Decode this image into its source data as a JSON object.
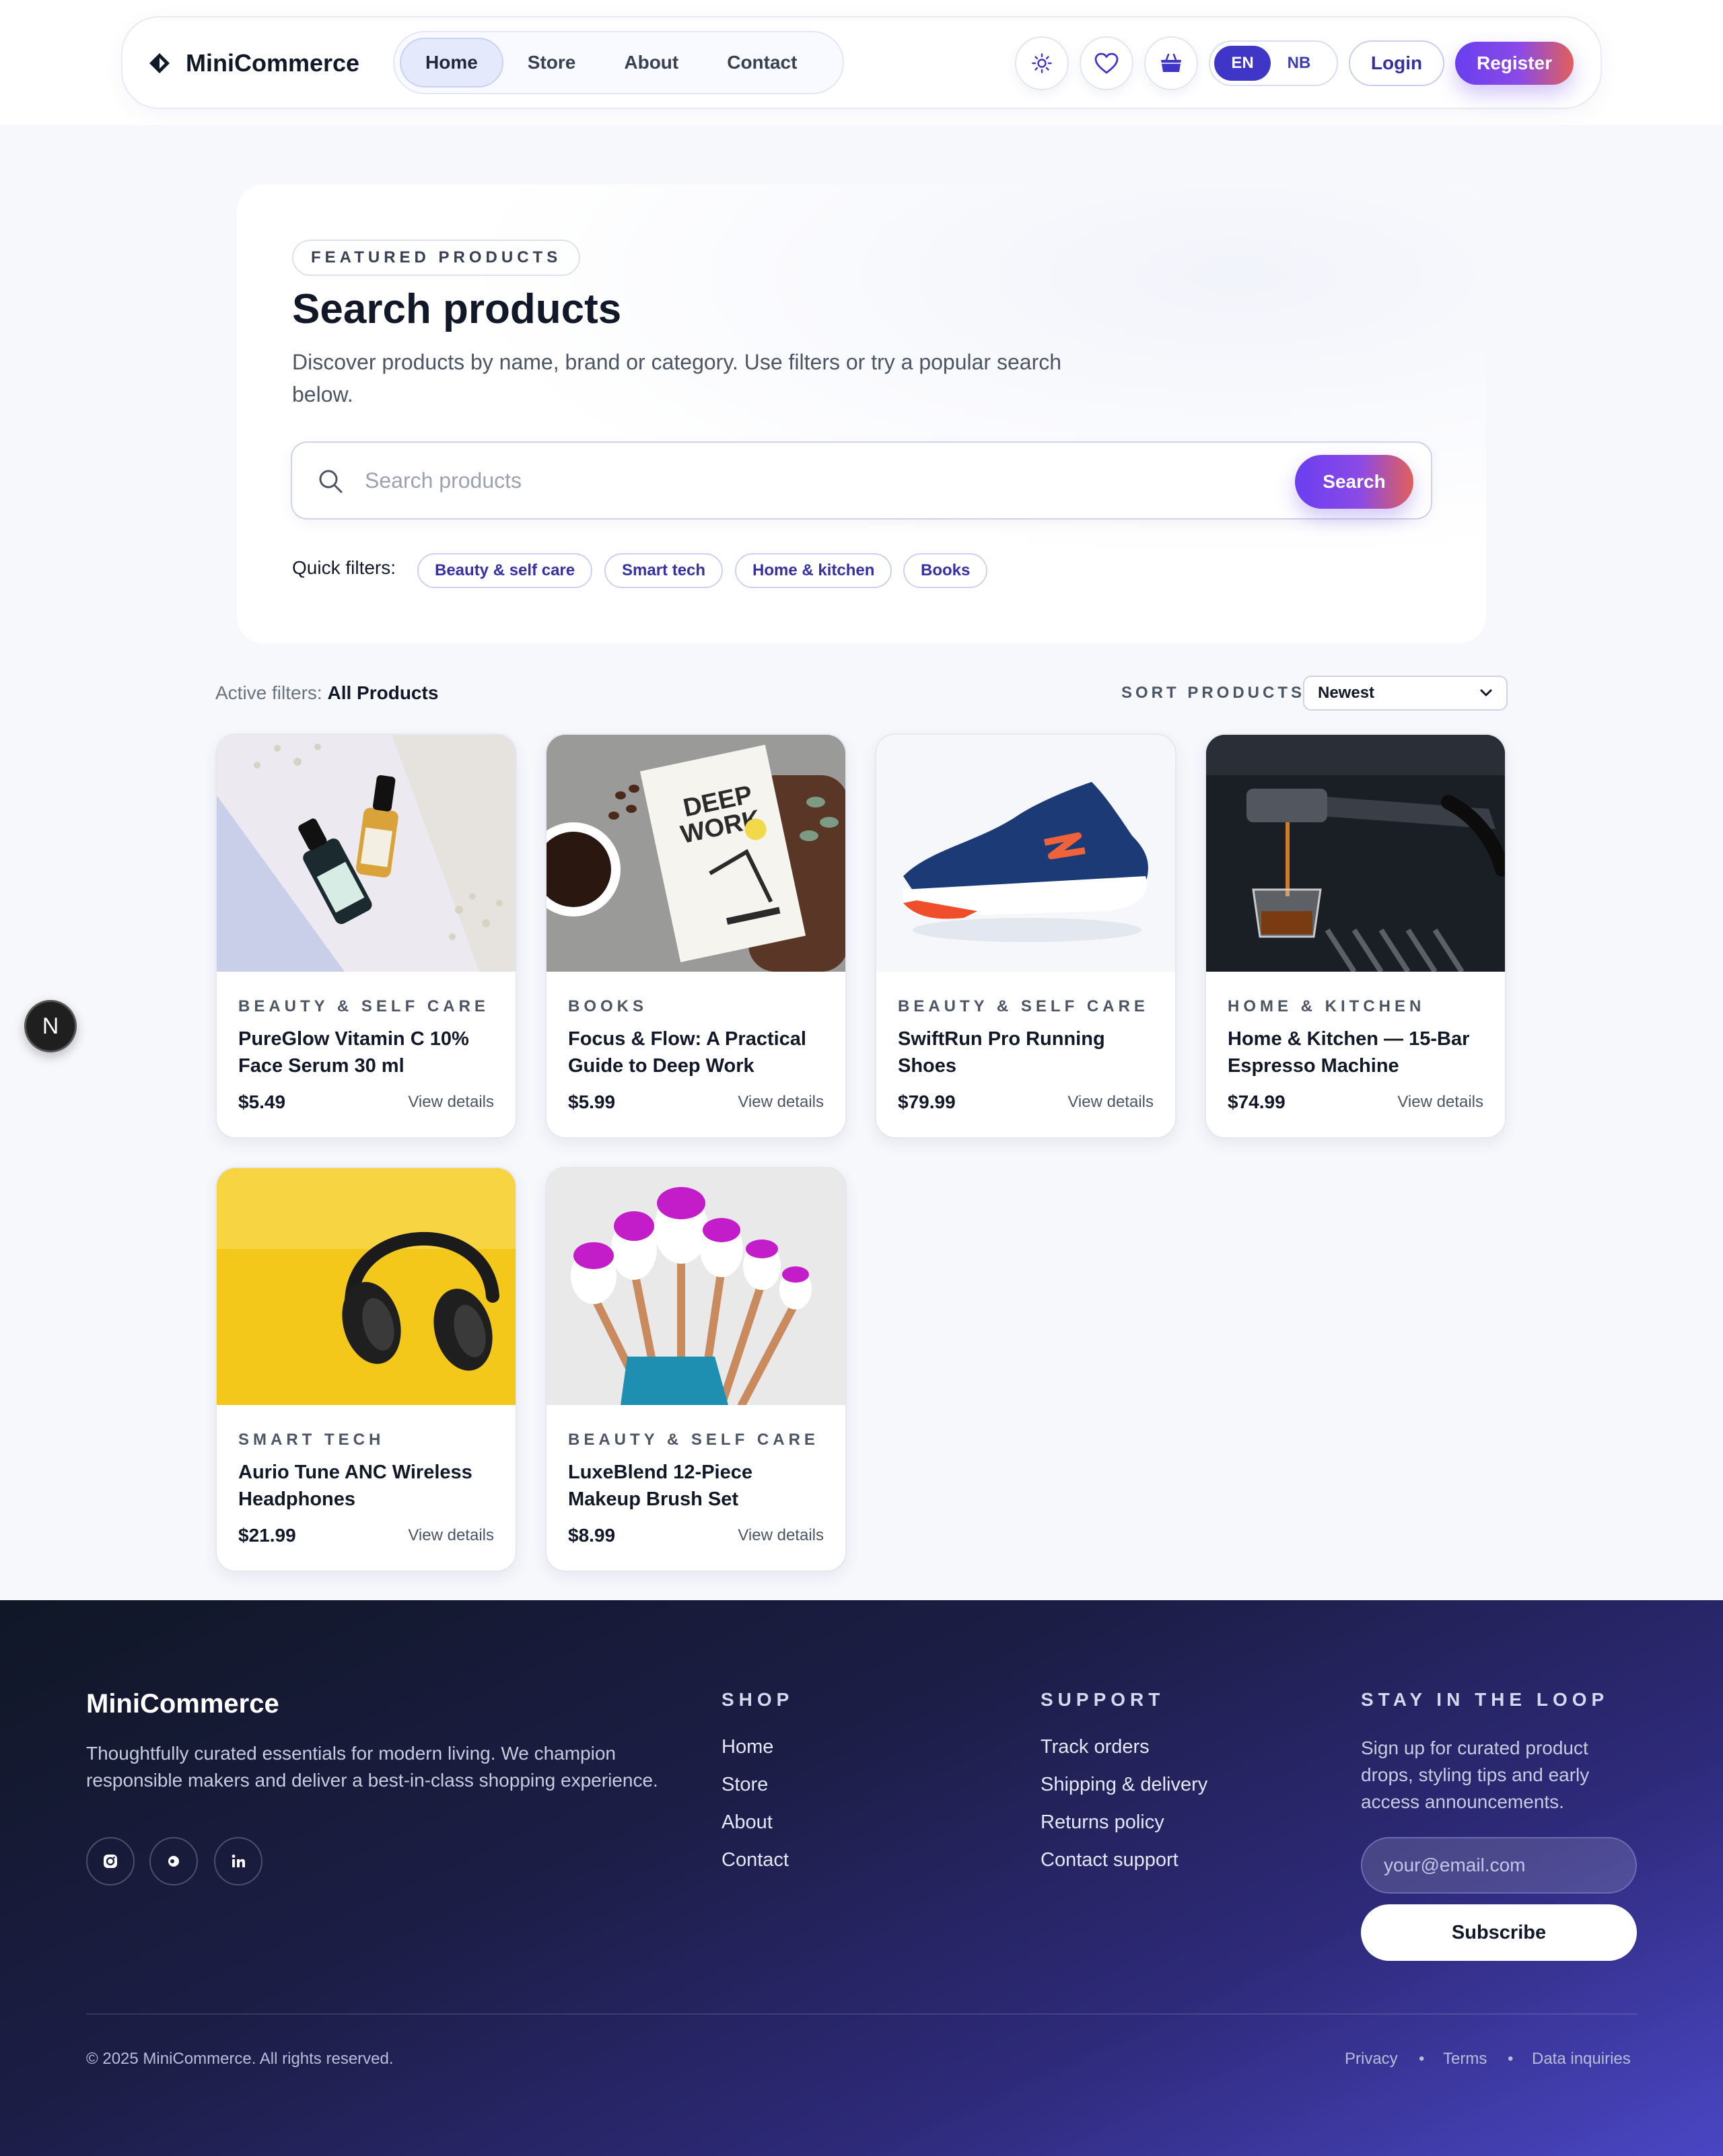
{
  "header": {
    "brand": "MiniCommerce",
    "nav": [
      {
        "label": "Home",
        "active": true
      },
      {
        "label": "Store"
      },
      {
        "label": "About"
      },
      {
        "label": "Contact"
      }
    ],
    "icons": [
      "sun-icon",
      "heart-icon",
      "basket-icon"
    ],
    "languages": [
      "EN",
      "NB"
    ],
    "active_language": "EN",
    "login": "Login",
    "register": "Register"
  },
  "hero": {
    "eyebrow": "FEATURED PRODUCTS",
    "title": "Search products",
    "subtitle": "Discover products by name, brand or category. Use filters or try a popular search below.",
    "search_placeholder": "Search products",
    "search_button": "Search",
    "quick_filters_label": "Quick filters:",
    "quick_filters": [
      "Beauty & self care",
      "Smart tech",
      "Home & kitchen",
      "Books"
    ]
  },
  "filters": {
    "active_label": "Active filters:",
    "active_value": "All Products",
    "sort_label": "SORT PRODUCTS",
    "sort_value": "Newest"
  },
  "products": [
    {
      "category": "BEAUTY & SELF CARE",
      "title": "PureGlow Vitamin C 10% Face Serum 30 ml",
      "price": "$5.49",
      "link": "View details"
    },
    {
      "category": "BOOKS",
      "title": "Focus & Flow: A Practical Guide to Deep Work",
      "price": "$5.99",
      "link": "View details"
    },
    {
      "category": "BEAUTY & SELF CARE",
      "title": "SwiftRun Pro Running Shoes",
      "price": "$79.99",
      "link": "View details"
    },
    {
      "category": "HOME & KITCHEN",
      "title": "Home & Kitchen — 15-Bar Espresso Machine",
      "price": "$74.99",
      "link": "View details"
    },
    {
      "category": "SMART TECH",
      "title": "Aurio Tune ANC Wireless Headphones",
      "price": "$21.99",
      "link": "View details"
    },
    {
      "category": "BEAUTY & SELF CARE",
      "title": "LuxeBlend 12-Piece Makeup Brush Set",
      "price": "$8.99",
      "link": "View details"
    }
  ],
  "book_cover": {
    "line1": "DEEP",
    "line2": "WORK"
  },
  "dev_badge": "N",
  "footer": {
    "brand": "MiniCommerce",
    "description": "Thoughtfully curated essentials for modern living. We champion responsible makers and deliver a best-in-class shopping experience.",
    "social_icons": [
      "instagram-icon",
      "threads-icon",
      "linkedin-icon"
    ],
    "shop_heading": "SHOP",
    "shop_links": [
      "Home",
      "Store",
      "About",
      "Contact"
    ],
    "support_heading": "SUPPORT",
    "support_links": [
      "Track orders",
      "Shipping & delivery",
      "Returns policy",
      "Contact support"
    ],
    "news_heading": "STAY IN THE LOOP",
    "news_text": "Sign up for curated product drops, styling tips and early access announcements.",
    "email_placeholder": "your@email.com",
    "subscribe": "Subscribe",
    "copyright": "© 2025 MiniCommerce. All rights reserved.",
    "legal": [
      "Privacy",
      "Terms",
      "Data inquiries"
    ]
  },
  "colors": {
    "accent": "#3f36c7",
    "gradient_start": "#6a3ef0",
    "gradient_end": "#e0605a",
    "footer_dark": "#101726",
    "footer_light": "#4a46c4"
  }
}
